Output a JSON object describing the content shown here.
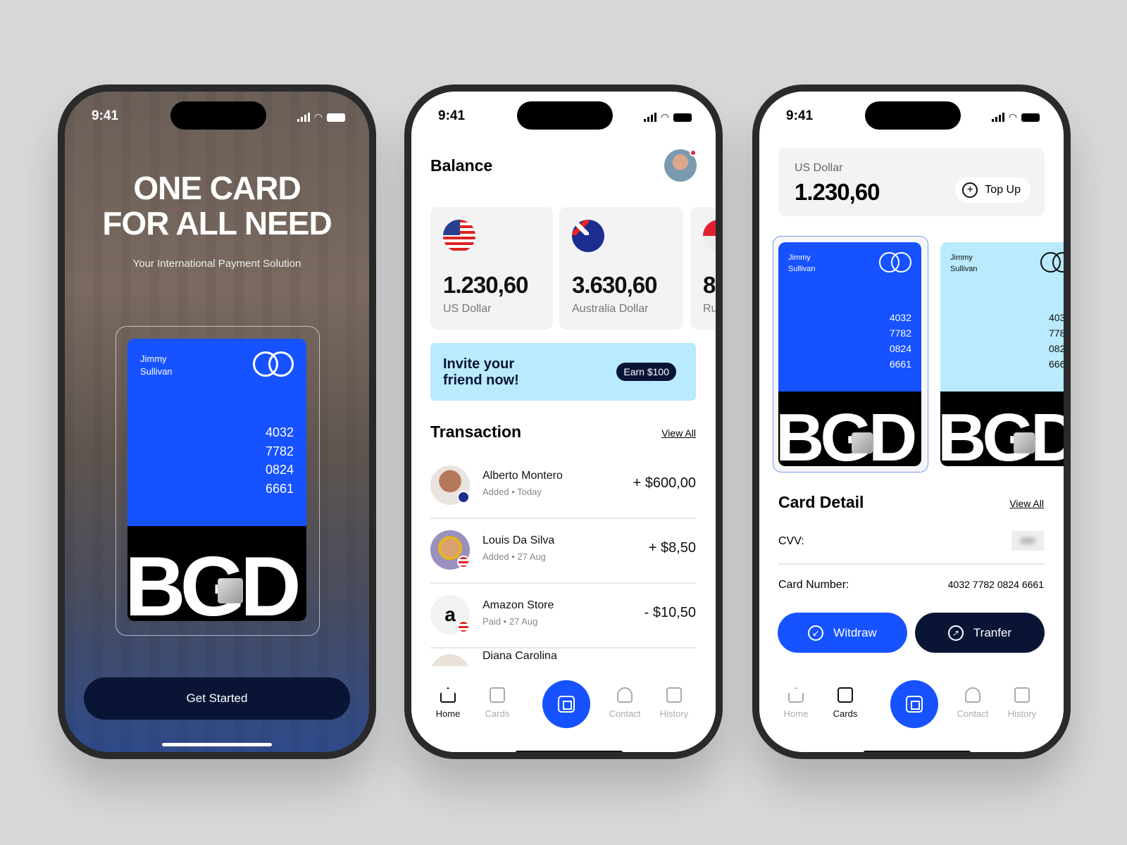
{
  "status": {
    "time": "9:41"
  },
  "onboarding": {
    "headline_1": "ONE CARD",
    "headline_2": "FOR ALL NEED",
    "subtitle": "Your International Payment Solution",
    "cta": "Get Started"
  },
  "card": {
    "first_name": "Jimmy",
    "last_name": "Sullivan",
    "number": [
      "4032",
      "7782",
      "0824",
      "6661"
    ],
    "brand": "BGD"
  },
  "home": {
    "title": "Balance",
    "balances": [
      {
        "amount": "1.230,60",
        "currency": "US Dollar"
      },
      {
        "amount": "3.630,60",
        "currency": "Australia Dollar"
      },
      {
        "amount": "8",
        "currency": "Ru"
      }
    ],
    "invite": {
      "text_1": "Invite your",
      "text_2": "friend now!",
      "badge": "Earn $100"
    },
    "transaction_title": "Transaction",
    "view_all": "View All",
    "transactions": [
      {
        "name": "Alberto Montero",
        "status": "Added",
        "date": "Today",
        "amount": "+ $600,00"
      },
      {
        "name": "Louis Da Silva",
        "status": "Added",
        "date": "27 Aug",
        "amount": "+ $8,50"
      },
      {
        "name": "Amazon Store",
        "status": "Paid",
        "date": "27 Aug",
        "amount": "- $10,50"
      },
      {
        "name": "Diana Carolina"
      }
    ]
  },
  "cards_screen": {
    "currency": "US Dollar",
    "amount": "1.230,60",
    "top_up": "Top Up",
    "detail_title": "Card Detail",
    "view_all": "View All",
    "cvv_label": "CVV:",
    "number_label": "Card Number:",
    "number_value": "4032 7782 0824 6661",
    "withdraw": "Witdraw",
    "transfer": "Tranfer"
  },
  "nav": {
    "home": "Home",
    "cards": "Cards",
    "contact": "Contact",
    "history": "History"
  },
  "colors": {
    "primary": "#1652ff",
    "navy": "#0a1536",
    "light_blue": "#b9eafd",
    "background": "#d7d8da"
  }
}
